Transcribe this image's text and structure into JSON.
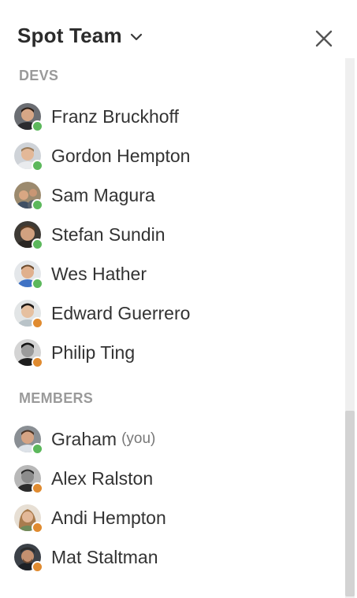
{
  "header": {
    "team_name": "Spot Team",
    "dropdown_icon": "chevron-down-icon",
    "close_icon": "close-icon"
  },
  "sections": {
    "devs": {
      "title": "DEVS",
      "members": [
        {
          "name": "Franz Bruckhoff",
          "status": "online",
          "status_color": "#5cb85c"
        },
        {
          "name": "Gordon Hempton",
          "status": "online",
          "status_color": "#5cb85c"
        },
        {
          "name": "Sam Magura",
          "status": "online",
          "status_color": "#5cb85c"
        },
        {
          "name": "Stefan Sundin",
          "status": "online",
          "status_color": "#5cb85c"
        },
        {
          "name": "Wes Hather",
          "status": "online",
          "status_color": "#5cb85c"
        },
        {
          "name": "Edward Guerrero",
          "status": "away",
          "status_color": "#e08b30"
        },
        {
          "name": "Philip Ting",
          "status": "away",
          "status_color": "#e08b30"
        }
      ]
    },
    "members": {
      "title": "MEMBERS",
      "members": [
        {
          "name": "Graham",
          "suffix": "(you)",
          "status": "online",
          "status_color": "#5cb85c"
        },
        {
          "name": "Alex Ralston",
          "status": "away",
          "status_color": "#e08b30"
        },
        {
          "name": "Andi Hempton",
          "status": "away",
          "status_color": "#e08b30"
        },
        {
          "name": "Mat Staltman",
          "status": "away",
          "status_color": "#e08b30"
        }
      ]
    }
  },
  "scrollbar": {
    "position_fraction": 0.66
  }
}
